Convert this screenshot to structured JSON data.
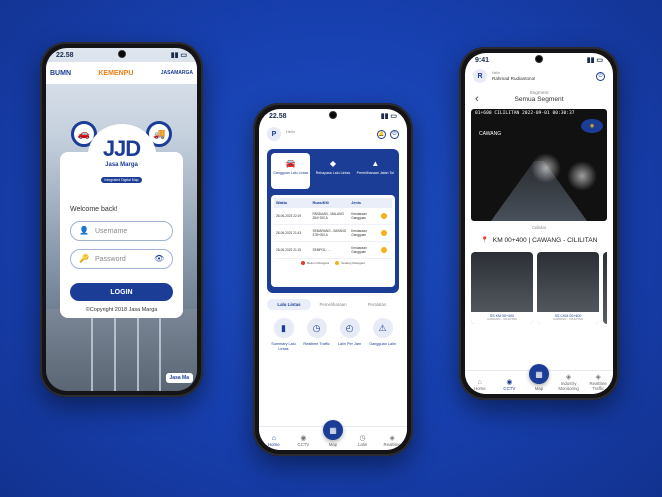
{
  "phone1": {
    "status_time": "22.58",
    "logos": [
      "BUMN",
      "KEMENPU",
      "JASAMARGA"
    ],
    "brand_text": "JJD",
    "brand_name": "Jasa Marga",
    "brand_sub": "Integrated Digital Map",
    "welcome": "Welcome back!",
    "username_placeholder": "Username",
    "password_placeholder": "Password",
    "login_label": "LOGIN",
    "copyright": "©Copyright 2018 Jasa Marga",
    "corner_tag": "Jasa Ma"
  },
  "phone2": {
    "status_time": "22.58",
    "avatar": "P",
    "hello": "Hello",
    "tiles": [
      {
        "icon": "car",
        "label": "Gangguan Lalu Lintas",
        "active": true
      },
      {
        "icon": "diamond",
        "label": "Rekayasa Lalu Lintas",
        "active": false
      },
      {
        "icon": "cone",
        "label": "Pemeliharaan Jalan Tol",
        "active": false
      }
    ],
    "table_headers": [
      "Waktu",
      "Ruas/KM",
      "Jenis"
    ],
    "rows": [
      {
        "waktu": "28-06-2023 22:19",
        "ruas": "PANDAAN - MALANG 284+200 A",
        "jenis": "Kendaraan Gangguan"
      },
      {
        "waktu": "28-06-2023 21:43",
        "ruas": "SEMARANG - BATANG 378+000 A",
        "jenis": "Kendaraan Gangguan"
      },
      {
        "waktu": "28-06-2023 21:15",
        "ruas": "SEMPOL - ...",
        "jenis": "Kendaraan Gangguan"
      }
    ],
    "legend": [
      "Belum Ditangani",
      "Sedang Ditangani"
    ],
    "tabs": [
      "Lalu Lintas",
      "Pemeliharaan",
      "Peralatan"
    ],
    "menu": [
      {
        "icon": "bars",
        "label": "Summary Lalu Lintas"
      },
      {
        "icon": "clock",
        "label": "Realtime Traffic"
      },
      {
        "icon": "clock",
        "label": "Lalin Per Jam"
      },
      {
        "icon": "warning",
        "label": "Gangguan Lalin"
      }
    ],
    "nav": [
      "Home",
      "CCTV",
      "Map",
      "Lalin",
      "Realtime"
    ]
  },
  "phone3": {
    "status_time": "9:41",
    "avatar": "R",
    "hello": "Hello",
    "username": "Rahmad Rudiantono!",
    "segment_label": "Segment",
    "segment_value": "Semua Segment",
    "cctv_timestamp": "01+600 CILILITAN 2022-09-01 00:30:37",
    "cctv_cam_label": "CAWANG",
    "cctv_caption": "Cellular",
    "location": "KM 00+400 | CAWANG - CILILITAN",
    "thumbs": [
      {
        "title": "SS KM 00+400",
        "sub": "CAWANG - CILILITAN"
      },
      {
        "title": "SS CKM 00+400",
        "sub": "CAWANG - CILILITAN"
      }
    ],
    "nav": [
      "Home",
      "CCTV",
      "Map",
      "Industry Monitoring",
      "Realtime Traffic"
    ]
  }
}
